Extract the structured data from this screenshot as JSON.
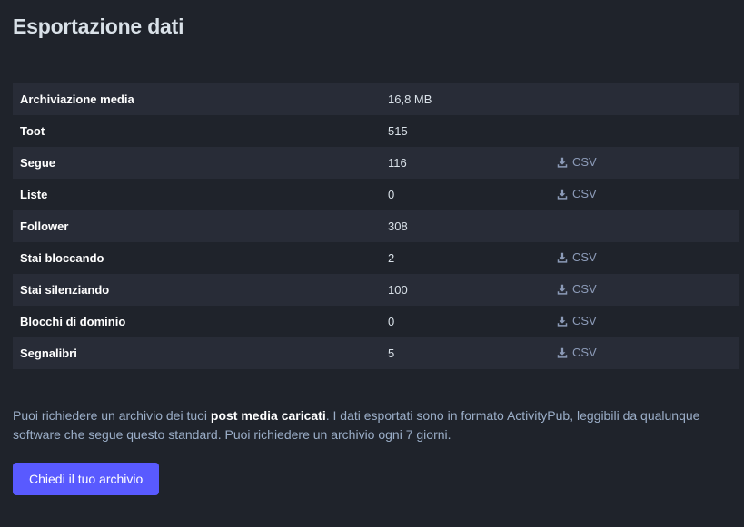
{
  "page": {
    "title": "Esportazione dati"
  },
  "export_table": {
    "rows": [
      {
        "label": "Archiviazione media",
        "value": "16,8 MB",
        "action": ""
      },
      {
        "label": "Toot",
        "value": "515",
        "action": ""
      },
      {
        "label": "Segue",
        "value": "116",
        "action": "CSV"
      },
      {
        "label": "Liste",
        "value": "0",
        "action": "CSV"
      },
      {
        "label": "Follower",
        "value": "308",
        "action": ""
      },
      {
        "label": "Stai bloccando",
        "value": "2",
        "action": "CSV"
      },
      {
        "label": "Stai silenziando",
        "value": "100",
        "action": "CSV"
      },
      {
        "label": "Blocchi di dominio",
        "value": "0",
        "action": "CSV"
      },
      {
        "label": "Segnalibri",
        "value": "5",
        "action": "CSV"
      }
    ],
    "download_icon": "download-icon"
  },
  "hint": {
    "before": "Puoi richiedere un archivio dei tuoi ",
    "strong": "post media caricati",
    "after": ". I dati esportati sono in formato ActivityPub, leggibili da qualunque software che segue questo standard. Puoi richiedere un archivio ogni 7 giorni."
  },
  "request_button": {
    "label": "Chiedi il tuo archivio"
  },
  "colors": {
    "background": "#1f232b",
    "row_alt": "#282c37",
    "accent": "#595aff",
    "muted": "#9baec8"
  }
}
